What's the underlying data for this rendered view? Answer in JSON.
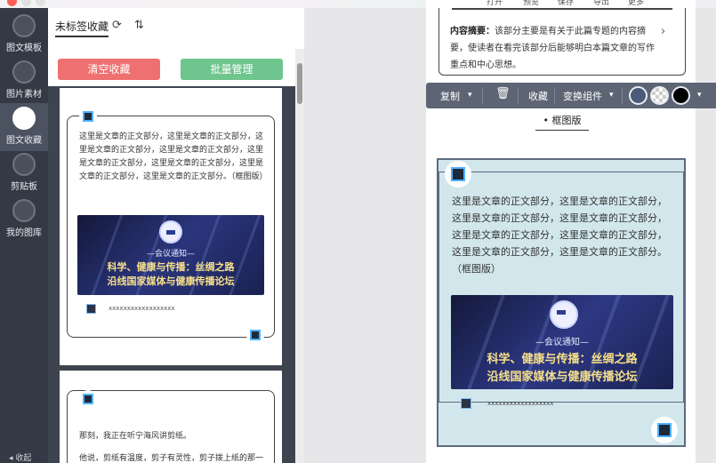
{
  "window": {
    "top_menu": [
      "打开",
      "预览",
      "保存",
      "导出",
      "更多"
    ]
  },
  "rail": {
    "items": [
      {
        "label": "图文模板",
        "icon": "template-icon"
      },
      {
        "label": "图片素材",
        "icon": "image-icon"
      },
      {
        "label": "图文收藏",
        "icon": "favorite-article-icon"
      },
      {
        "label": "剪贴板",
        "icon": "clipboard-icon"
      },
      {
        "label": "我的图库",
        "icon": "gallery-icon"
      }
    ],
    "active_index": 2,
    "collapse_label": "收起"
  },
  "panel": {
    "tab_label": "未标签收藏",
    "clear_button": "清空收藏",
    "batch_button": "批量管理",
    "card1": {
      "body": "这里是文章的正文部分，这里是文章的正文部分，这里是文章的正文部分，这里是文章的正文部分，这里是文章的正文部分，这里是文章的正文部分，这里是文章的正文部分，这里是文章的正文部分。（框图版）",
      "placeholder_line": "xxxxxxxxxxxxxxxxxx"
    },
    "card2": {
      "line1": "那刻，我正在听宁海风讲剪纸。",
      "line2": "他说，剪纸有温度，剪子有灵性，剪子拨上纸的那一"
    }
  },
  "banner": {
    "subtitle": "—会议通知—",
    "title_line1": "科学、健康与传播：丝绸之路",
    "title_line2": "沿线国家媒体与健康传播论坛"
  },
  "editor": {
    "summary_label": "内容摘要：",
    "summary_text": "该部分主要是有关于此篇专题的内容摘要，使读者在看完该部分后能够明白本篇文章的写作重点和中心思想。",
    "toolbar": {
      "copy": "复制",
      "favorite": "收藏",
      "transform": "变换组件",
      "colors": [
        "#4a5a78",
        "#e0e0e0",
        "#000000"
      ]
    },
    "caption": "框图版",
    "block_text": "这里是文章的正文部分，这里是文章的正文部分，这里是文章的正文部分，这里是文章的正文部分，这里是文章的正文部分，这里是文章的正文部分，这里是文章的正文部分，这里是文章的正文部分。（框图版）",
    "placeholder_line": "xxxxxxxxxxxxxxxxxx"
  }
}
